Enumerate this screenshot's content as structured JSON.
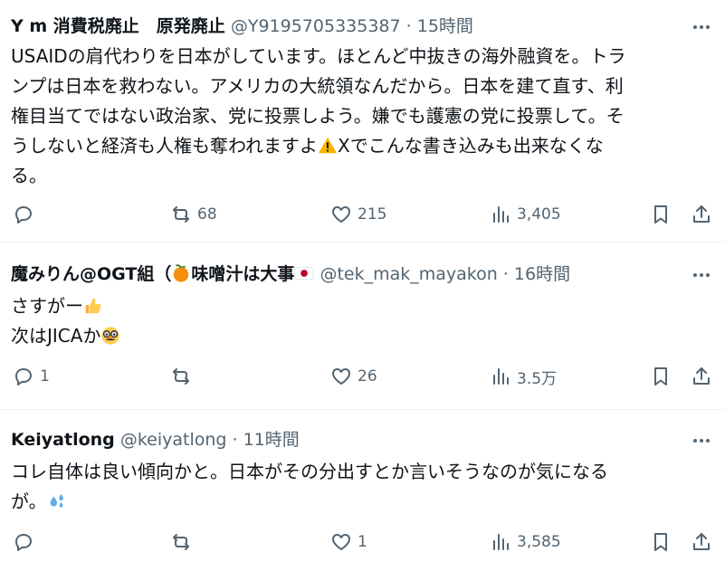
{
  "posts": [
    {
      "author": "Y m 消費税廃止　原発廃止",
      "handle": "@Y9195705335387",
      "time": "15時間",
      "text_line1": "USAIDの肩代わりを日本がしています。ほとんど中抜きの海外融資を。トラ",
      "text_line2": "ンプは日本を救わない。アメリカの大統領なんだから。日本を建て直す、利",
      "text_line3": "権目当てではない政治家、党に投票しよう。嫌でも護憲の党に投票して。そ",
      "text_line4a": "うしないと経済も人権も奪われますよ",
      "text_line4b": "Xでこんな書き込みも出来なくな",
      "text_line5": "る。",
      "replies": "",
      "reposts": "68",
      "likes": "215",
      "views": "3,405"
    },
    {
      "author_a": "魔みりん@OGT組（",
      "author_b": "味噌汁は大事",
      "handle": "@tek_mak_mayakon",
      "time": "16時間",
      "text_line1": "さすがー",
      "text_line2": "次はJICAか",
      "replies": "1",
      "reposts": "",
      "likes": "26",
      "views": "3.5万"
    },
    {
      "author": "Keiyatlong",
      "handle": "@keiyatlong",
      "time": "11時間",
      "text_line1": "コレ自体は良い傾向かと。日本がその分出すとか言いそうなのが気になる",
      "text_line2": "が。",
      "replies": "",
      "reposts": "",
      "likes": "1",
      "views": "3,585"
    }
  ],
  "separator": " · ",
  "icons": [
    "reply-icon",
    "repost-icon",
    "like-icon",
    "views-icon",
    "bookmark-icon",
    "share-icon",
    "more-icon",
    "warning-emoji",
    "tangerine-emoji",
    "japan-flag-emoji",
    "thumbs-up-emoji",
    "disguise-face-emoji",
    "sweat-droplets-emoji"
  ]
}
